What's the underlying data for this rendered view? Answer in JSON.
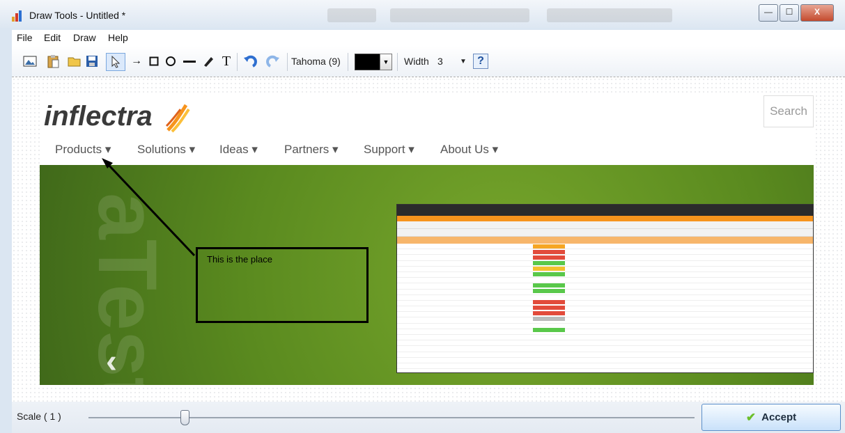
{
  "window": {
    "title": "Draw Tools - Untitled *",
    "controls": {
      "minimize": "—",
      "maximize": "☐",
      "close": "X"
    }
  },
  "menu": [
    "File",
    "Edit",
    "Draw",
    "Help"
  ],
  "toolbar": {
    "font_label": "Tahoma (9)",
    "color": "#000000",
    "width_label": "Width",
    "width_value": "3",
    "help_glyph": "?"
  },
  "embedded_page": {
    "logo_text": "inflectra",
    "search_label": "Search",
    "nav": [
      "Products",
      "Solutions",
      "Ideas",
      "Partners",
      "Support",
      "About Us"
    ],
    "hero_letters": "aTest"
  },
  "annotation": {
    "text": "This is the place"
  },
  "bottombar": {
    "scale_label": "Scale ( 1 )",
    "scale_value": 1,
    "accept_label": "Accept"
  },
  "colors": {
    "accent": "#6cbf2b",
    "hero_green": "#5a8a1f",
    "tab_orange": "#f7941d"
  }
}
